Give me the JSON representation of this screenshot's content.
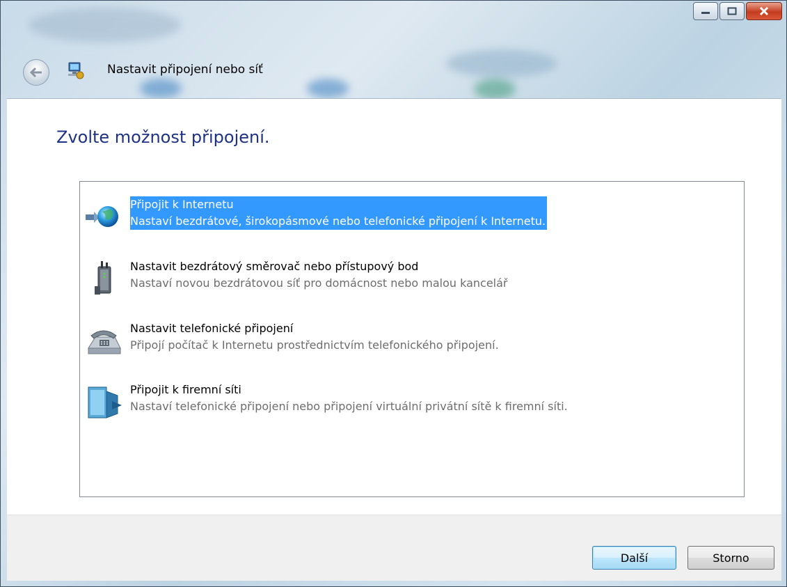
{
  "window": {
    "title": "Nastavit připojení nebo síť"
  },
  "heading": "Zvolte možnost připojení.",
  "options": [
    {
      "title": "Připojit k Internetu",
      "description": "Nastaví bezdrátové, širokopásmové nebo telefonické připojení k Internetu.",
      "icon": "globe-connect-icon",
      "selected": true
    },
    {
      "title": "Nastavit bezdrátový směrovač nebo přístupový bod",
      "description": "Nastaví novou bezdrátovou síť pro domácnost nebo malou kancelář",
      "icon": "wireless-router-icon",
      "selected": false
    },
    {
      "title": "Nastavit telefonické připojení",
      "description": "Připojí počítač k Internetu prostřednictvím telefonického připojení.",
      "icon": "telephone-icon",
      "selected": false
    },
    {
      "title": "Připojit k firemní síti",
      "description": "Nastaví telefonické připojení nebo připojení virtuální privátní sítě k firemní síti.",
      "icon": "workplace-building-icon",
      "selected": false
    }
  ],
  "buttons": {
    "next": "Další",
    "cancel": "Storno"
  },
  "colors": {
    "heading": "#1e3287",
    "selection": "#3399ff",
    "description": "#6d6d6d"
  }
}
